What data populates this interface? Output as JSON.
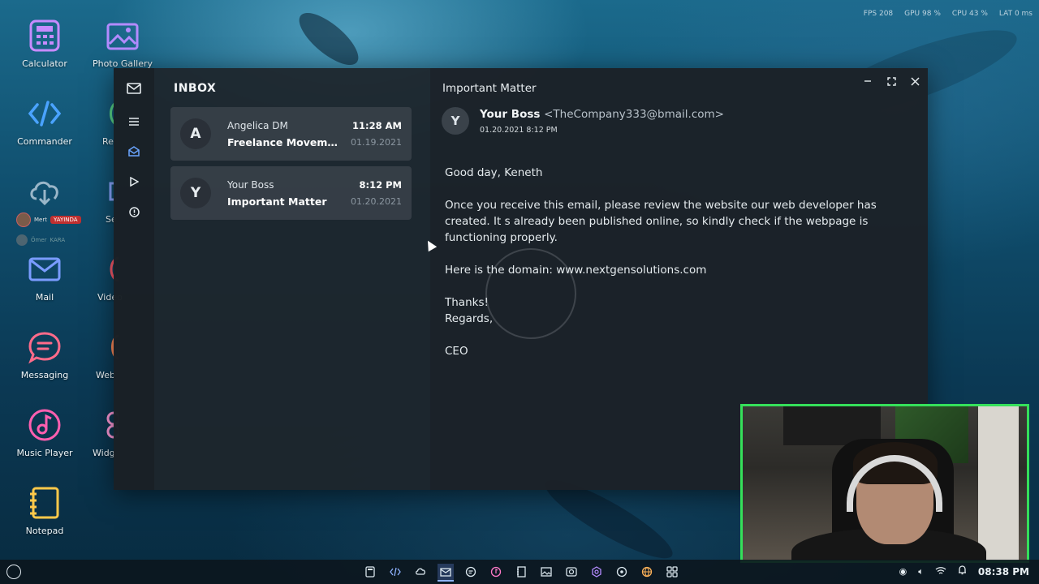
{
  "stats": {
    "fps": "FPS 208",
    "gpu": "GPU 98 %",
    "cpu": "CPU 43 %",
    "lat": "LAT 0 ms"
  },
  "desktop": {
    "icons": [
      {
        "label": "Calculator",
        "icon": "calculator-icon"
      },
      {
        "label": "Photo Gallery",
        "icon": "photo-gallery-icon"
      },
      {
        "label": "Commander",
        "icon": "code-icon"
      },
      {
        "label": "Re",
        "icon": "recorder-icon"
      },
      {
        "label": "",
        "icon": "cloud-download-icon"
      },
      {
        "label": "Se",
        "icon": "settings-icon"
      },
      {
        "label": "Mail",
        "icon": "mail-icon"
      },
      {
        "label": "Video",
        "icon": "video-icon"
      },
      {
        "label": "Messaging",
        "icon": "chat-icon"
      },
      {
        "label": "Web",
        "icon": "web-icon"
      },
      {
        "label": "Music Player",
        "icon": "music-icon"
      },
      {
        "label": "Widg",
        "icon": "widgets-icon"
      },
      {
        "label": "Notepad",
        "icon": "notepad-icon"
      }
    ],
    "user1": {
      "name": "Mert",
      "tag": "YAYINDA"
    },
    "user2": {
      "name": "Ömer",
      "tag": "KARA"
    }
  },
  "mail": {
    "inbox_title": "INBOX",
    "messages": [
      {
        "avatar": "A",
        "sender": "Angelica DM",
        "subject": "Freelance Moveme...",
        "time": "11:28 AM",
        "date": "01.19.2021"
      },
      {
        "avatar": "Y",
        "sender": "Your Boss",
        "subject": "Important Matter",
        "time": "8:12 PM",
        "date": "01.20.2021"
      }
    ],
    "open": {
      "subject": "Important Matter",
      "avatar": "Y",
      "from_name": "Your Boss",
      "from_email": "<TheCompany333@bmail.com>",
      "datetime": "01.20.2021  8:12 PM",
      "greeting": "Good day, Keneth",
      "para1": "Once you receive this email, please review the website our web developer has created. It s already been published online, so kindly check if the webpage is functioning properly.",
      "para2": "Here is the domain: www.nextgensolutions.com",
      "thanks": "Thanks!",
      "regards": "Regards,",
      "signature": "CEO"
    }
  },
  "taskbar": {
    "clock": "08:38 PM"
  },
  "colors": {
    "accent": "#6aa5ff",
    "webcam_border": "#35e05a",
    "live_tag": "#c03030"
  }
}
